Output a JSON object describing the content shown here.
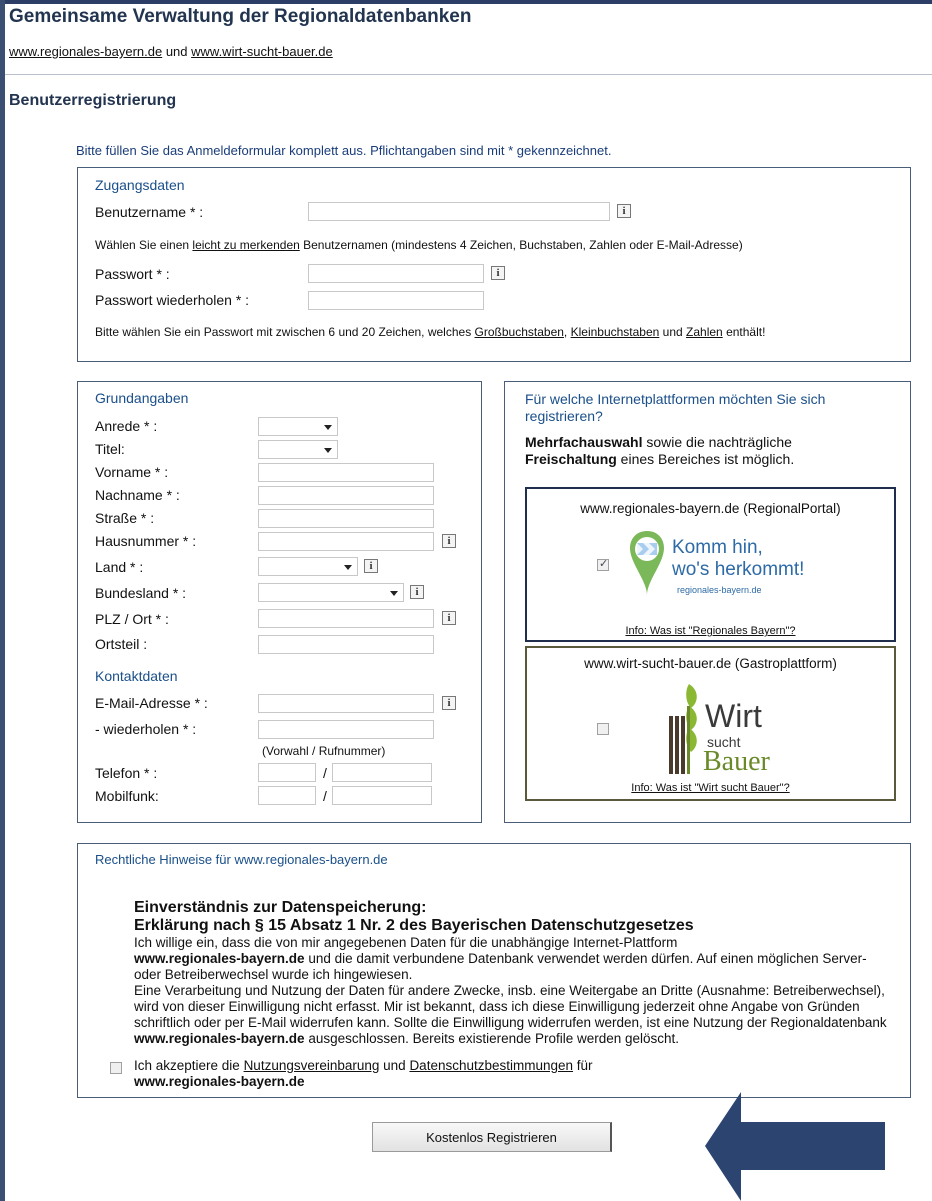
{
  "header": {
    "title": "Gemeinsame Verwaltung der Regionaldatenbanken",
    "link1": "www.regionales-bayern.de",
    "link_joiner": " und ",
    "link2": "www.wirt-sucht-bauer.de"
  },
  "page": {
    "section_title": "Benutzerregistrierung",
    "intro": "Bitte füllen Sie das Anmeldeformular komplett aus. Pflichtangaben sind mit * gekennzeichnet."
  },
  "zugang": {
    "legend": "Zugangsdaten",
    "username_label": "Benutzername * :",
    "username_hint_pre": "Wählen Sie einen ",
    "username_hint_link": "leicht zu merkenden",
    "username_hint_post": " Benutzernamen (mindestens 4 Zeichen, Buchstaben, Zahlen oder E-Mail-Adresse)",
    "password_label": "Passwort * :",
    "password_repeat_label": "Passwort wiederholen * :",
    "password_hint_pre": "Bitte wählen Sie ein Passwort mit zwischen 6 und 20 Zeichen, welches ",
    "password_hint_l1": "Großbuchstaben",
    "password_hint_sep": ", ",
    "password_hint_l2": "Kleinbuchstaben",
    "password_hint_and": " und ",
    "password_hint_l3": "Zahlen",
    "password_hint_post": " enthält!",
    "info_glyph": "i"
  },
  "grund": {
    "legend": "Grundangaben",
    "anrede": "Anrede * :",
    "titel": "Titel:",
    "vorname": "Vorname * :",
    "nachname": "Nachname * :",
    "strasse": "Straße * :",
    "hausnummer": "Hausnummer * :",
    "land": "Land * :",
    "bundesland": "Bundesland * :",
    "plz": "PLZ / Ort * :",
    "ortsteil": "Ortsteil :",
    "kontakt_legend": "Kontaktdaten",
    "email": "E-Mail-Adresse * :",
    "email_repeat": "- wiederholen * :",
    "phone_hint": "(Vorwahl / Rufnummer)",
    "telefon": "Telefon * :",
    "mobil": "Mobilfunk:",
    "slash": "/"
  },
  "platforms": {
    "question": "Für welche Internetplattformen möchten Sie sich registrieren?",
    "multi_bold1": "Mehrfachauswahl",
    "multi_text1": " sowie die nachträgliche",
    "multi_bold2": "Freischaltung",
    "multi_text2": " eines Bereiches ist möglich.",
    "rb_title": "www.regionales-bayern.de (RegionalPortal)",
    "rb_logo_line1": "Komm hin,",
    "rb_logo_line2": "wo's herkommt!",
    "rb_logo_url": "regionales-bayern.de",
    "rb_info": "Info: Was ist \"Regionales Bayern\"?",
    "wsb_title": "www.wirt-sucht-bauer.de (Gastroplattform)",
    "wsb_logo_line1": "Wirt",
    "wsb_logo_line2": "sucht",
    "wsb_logo_line3": "Bauer",
    "wsb_info": "Info: Was ist \"Wirt sucht Bauer\"?",
    "rb_checked": true,
    "wsb_checked": false
  },
  "legal": {
    "legend": "Rechtliche Hinweise für www.regionales-bayern.de",
    "heading1": "Einverständnis zur Datenspeicherung:",
    "heading2": "Erklärung nach § 15 Absatz 1 Nr. 2 des Bayerischen Datenschutzgesetzes",
    "p1": "Ich willige ein, dass die von mir angegebenen Daten für die unabhängige Internet-Plattform",
    "p2_bold": "www.regionales-bayern.de",
    "p2": " und die damit verbundene Datenbank verwendet werden dürfen. Auf einen möglichen Server- oder Betreiberwechsel wurde ich hingewiesen.",
    "p3": "Eine Verarbeitung und Nutzung der Daten für andere Zwecke, insb. eine Weitergabe an Dritte (Ausnahme: Betreiberwechsel), wird von dieser Einwilligung nicht erfasst. Mir ist bekannt, dass ich diese Einwilligung jederzeit ohne Angabe von Gründen schriftlich oder per E-Mail widerrufen kann. Sollte die Einwilligung widerrufen werden, ist eine Nutzung der Regionaldatenbank",
    "p4_bold": "www.regionales-bayern.de",
    "p4": " ausgeschlossen. Bereits existierende Profile werden gelöscht.",
    "accept_pre": "Ich akzeptiere die ",
    "accept_l1": "Nutzungsvereinbarung",
    "accept_and": " und ",
    "accept_l2": "Datenschutzbestimmungen",
    "accept_post": " für",
    "accept_bold": "www.regionales-bayern.de"
  },
  "submit": {
    "label": "Kostenlos Registrieren"
  },
  "colors": {
    "arrow": "#2b4570",
    "legend": "#1a4f8a",
    "title": "#22344f"
  },
  "icons": {
    "info": "info-icon",
    "arrow": "arrow-left-icon"
  }
}
